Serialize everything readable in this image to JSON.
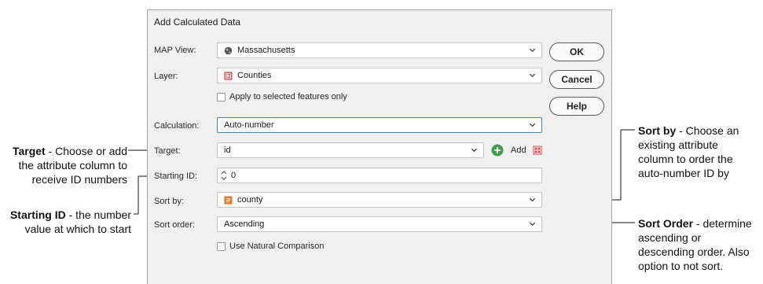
{
  "dialog": {
    "title": "Add Calculated Data",
    "map_view": {
      "label": "MAP View:",
      "value": "Massachusetts",
      "icon": "globe-icon"
    },
    "layer": {
      "label": "Layer:",
      "value": "Counties",
      "icon": "table-layer-icon"
    },
    "apply_selected": {
      "label": "Apply to selected features only",
      "checked": false
    },
    "calculation": {
      "label": "Calculation:",
      "value": "Auto-number"
    },
    "target": {
      "label": "Target:",
      "value": "id",
      "add_label": "Add"
    },
    "starting_id": {
      "label": "Starting ID:",
      "value": "0"
    },
    "sort_by": {
      "label": "Sort by:",
      "value": "county",
      "icon": "field-icon"
    },
    "sort_order": {
      "label": "Sort order:",
      "value": "Ascending"
    },
    "natural_comparison": {
      "label": "Use Natural Comparison",
      "checked": false
    },
    "buttons": {
      "ok": "OK",
      "cancel": "Cancel",
      "help": "Help"
    }
  },
  "callouts": {
    "target": {
      "title": "Target",
      "line1": " - Choose or add",
      "line2": "the attribute column to",
      "line3": "receive ID numbers"
    },
    "starting_id": {
      "title": "Starting ID",
      "line1": " - the number",
      "line2": "value at which to start"
    },
    "sort_by": {
      "title": "Sort by",
      "line1": " - Choose an",
      "line2": "existing attribute",
      "line3": "column to order the",
      "line4": "auto-number ID by"
    },
    "sort_order": {
      "title": "Sort Order",
      "line1": " - determine",
      "line2": "ascending or",
      "line3": "descending order. Also",
      "line4": "option to not sort."
    }
  },
  "colors": {
    "accent_blue": "#4a7fc1",
    "add_green": "#3aa14a",
    "icon_red": "#d9414a",
    "icon_orange": "#e07a2e",
    "globe_gray": "#555555"
  }
}
